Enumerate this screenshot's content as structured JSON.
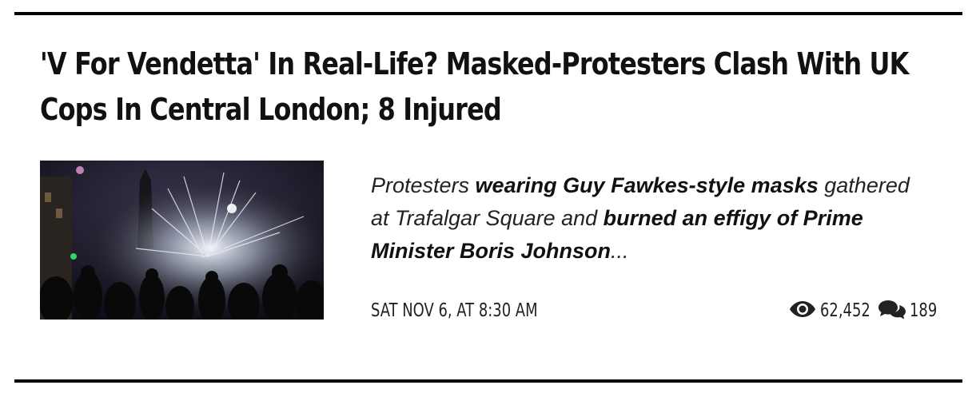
{
  "article": {
    "headline": "'V For Vendetta' In Real-Life? Masked-Protesters Clash With UK Cops In Central London; 8 Injured",
    "teaser": {
      "part1": "Protesters ",
      "bold1": "wearing Guy Fawkes-style masks",
      "part2": " gathered at Trafalgar Square and ",
      "bold2": "burned an effigy of Prime Minister Boris Johnson",
      "part3": "..."
    },
    "date": "SAT NOV 6, AT 8:30 AM",
    "views": "62,452",
    "comments": "189",
    "icons": {
      "views": "eye-icon",
      "comments": "comments-icon"
    }
  }
}
